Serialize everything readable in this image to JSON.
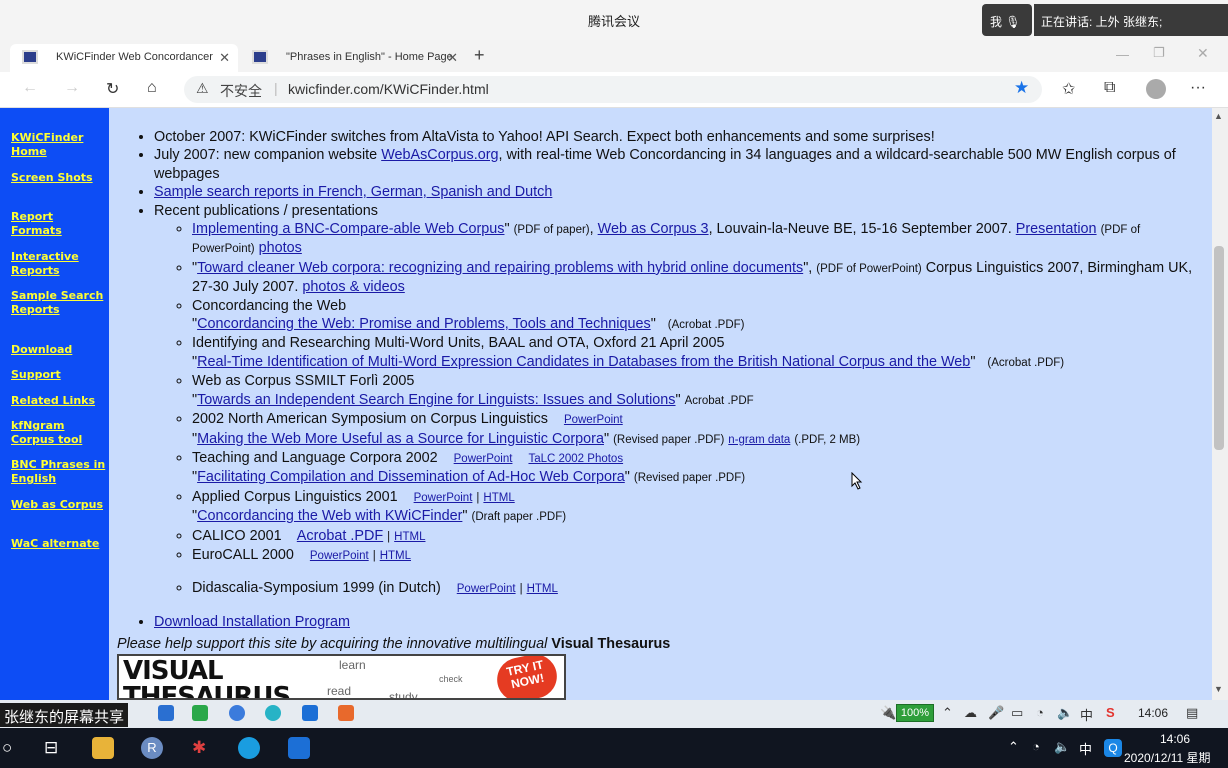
{
  "meeting": {
    "title": "腾讯会议",
    "me": "我",
    "speaking": "正在讲话: 上外 张继东;",
    "share_label": "张继东的屏幕共享"
  },
  "browser": {
    "tabs": [
      {
        "label": "KWiCFinder Web Concordancer"
      },
      {
        "label": "\"Phrases in English\" - Home Page"
      }
    ],
    "address": {
      "insecure_label": "不安全",
      "url": "kwicfinder.com/KWiCFinder.html"
    }
  },
  "sidebar": {
    "items": [
      {
        "label": "KWiCFinder Home"
      },
      {
        "label": "Screen Shots"
      },
      {
        "label": "Report Formats"
      },
      {
        "label": "Interactive Reports"
      },
      {
        "label": "Sample Search Reports"
      },
      {
        "label": "Download"
      },
      {
        "label": "Support"
      },
      {
        "label": "Related Links"
      },
      {
        "label": "kfNgram Corpus tool"
      },
      {
        "label": "BNC Phrases in English"
      },
      {
        "label": "Web as Corpus"
      },
      {
        "label": "WaC alternate"
      }
    ]
  },
  "content": {
    "news1": "October 2007:  KWiCFinder switches from AltaVista to Yahoo! API Search.  Expect both enhancements and some surprises!",
    "news2_a": "July 2007:  new companion website ",
    "news2_link": "WebAsCorpus.org",
    "news2_b": ", with real-time Web Concordancing in 34 languages and a wildcard-searchable 500 MW English corpus of webpages",
    "sample_link": "Sample search reports in French, German, Spanish and Dutch",
    "recent": "Recent publications / presentations",
    "pubs": {
      "p1_title": "Implementing a BNC-Compare-able Web Corpus",
      "p1_pdf": "(PDF of paper)",
      "p1_wac": "Web as Corpus 3",
      "p1_place": ", Louvain-la-Neuve BE, 15-16 September 2007.   ",
      "p1_pres": "Presentation",
      "p1_pdfpp": "(PDF of PowerPoint)",
      "p1_photos": "photos",
      "p2_title": "Toward cleaner Web corpora: recognizing and repairing problems with hybrid online documents",
      "p2_pdfpp": "(PDF of PowerPoint)",
      "p2_conf": " Corpus Linguistics 2007, Birmingham UK, 27-30 July 2007. ",
      "p2_photos": "photos & videos",
      "p3_event": "Concordancing the Web",
      "p3_title": "Concordancing the Web: Promise and Problems, Tools and Techniques",
      "p3_fmt": "(Acrobat .PDF)",
      "p4_event": "Identifying and Researching Multi-Word Units, BAAL and OTA, Oxford 21 April 2005",
      "p4_title": "Real-Time Identification of Multi-Word Expression Candidates in Databases from the British National Corpus and the Web",
      "p4_fmt": "(Acrobat .PDF)",
      "p5_event": "Web as Corpus SSMILT Forlì 2005",
      "p5_title": "Towards an Independent Search Engine for Linguists:  Issues and Solutions",
      "p5_fmt": "Acrobat .PDF",
      "p6_event": "2002 North American Symposium on Corpus Linguistics",
      "p6_pp": "PowerPoint",
      "p6_title": "Making the Web More Useful as a Source for Linguistic Corpora",
      "p6_fmt": "(Revised paper .PDF)",
      "p6_ngram": "n-gram data",
      "p6_ngram_fmt": "(.PDF, 2 MB)",
      "p7_event": "Teaching and Language Corpora 2002",
      "p7_pp": "PowerPoint",
      "p7_photos": "TaLC 2002 Photos",
      "p7_title": "Facilitating Compilation and Dissemination of Ad-Hoc Web Corpora",
      "p7_fmt": "(Revised paper .PDF)",
      "p8_event": "Applied Corpus Linguistics 2001",
      "p8_pp": "PowerPoint",
      "p8_html": "HTML",
      "p8_title": "Concordancing the Web with KWiCFinder",
      "p8_fmt": "(Draft paper .PDF)",
      "p9_event": "CALICO 2001",
      "p9_pdf": "Acrobat .PDF",
      "p9_html": "HTML",
      "p10_event": "EuroCALL 2000",
      "p10_pp": "PowerPoint",
      "p10_html": "HTML",
      "p11_event": "Didascalia-Symposium 1999 (in Dutch)",
      "p11_pp": "PowerPoint",
      "p11_html": "HTML"
    },
    "download_link": "Download Installation Program",
    "support_text": "Please help support this site by acquiring the innovative multilingual ",
    "support_bold": "Visual Thesaurus",
    "banner": {
      "logo_line1": "VISUAL",
      "logo_line2": "THESAURUS",
      "words": [
        "learn",
        "read",
        "study",
        "check"
      ],
      "badge": "TRY IT NOW!"
    }
  },
  "inner_taskbar": {
    "battery": "100%",
    "ime": "中",
    "clock": "14:06"
  },
  "outer_taskbar": {
    "ime": "中",
    "time": "14:06",
    "date": "2020/12/11 星期"
  }
}
